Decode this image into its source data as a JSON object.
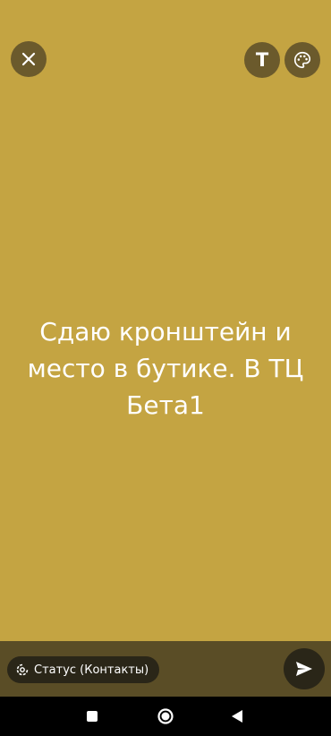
{
  "status_editor": {
    "text": "Сдаю кронштейн и место в бутике. В ТЦ Бета1",
    "background_color": "#c4a442"
  },
  "toolbar": {
    "close_icon": "close-icon",
    "text_tool_label": "T",
    "palette_icon": "palette-icon"
  },
  "footer": {
    "audience_label": "Статус (Контакты)",
    "audience_icon": "status-ring-icon",
    "send_icon": "send-icon"
  },
  "navigation": {
    "recents_icon": "recents-icon",
    "home_icon": "home-icon",
    "back_icon": "back-icon"
  }
}
